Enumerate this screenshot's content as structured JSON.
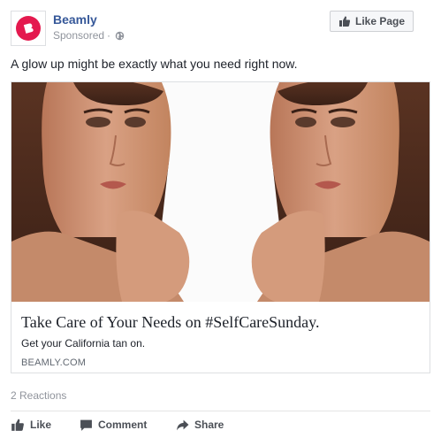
{
  "header": {
    "page_name": "Beamly",
    "sponsored": "Sponsored",
    "separator": "·",
    "like_page_label": "Like Page"
  },
  "post": {
    "text": "A glow up might be exactly what you need right now."
  },
  "ad": {
    "title": "Take Care of Your Needs on #SelfCareSunday.",
    "description": "Get your California tan on.",
    "domain": "BEAMLY.COM"
  },
  "footer": {
    "reactions": "2 Reactions",
    "actions": {
      "like": "Like",
      "comment": "Comment",
      "share": "Share"
    }
  },
  "colors": {
    "brand": "#e4194e",
    "link": "#365899",
    "muted": "#90949c",
    "text": "#1d2129"
  },
  "icons": {
    "logo": "beamly-logo-icon",
    "globe": "globe-icon",
    "thumbs_up": "thumbs-up-icon",
    "comment": "comment-icon",
    "share": "share-icon"
  }
}
